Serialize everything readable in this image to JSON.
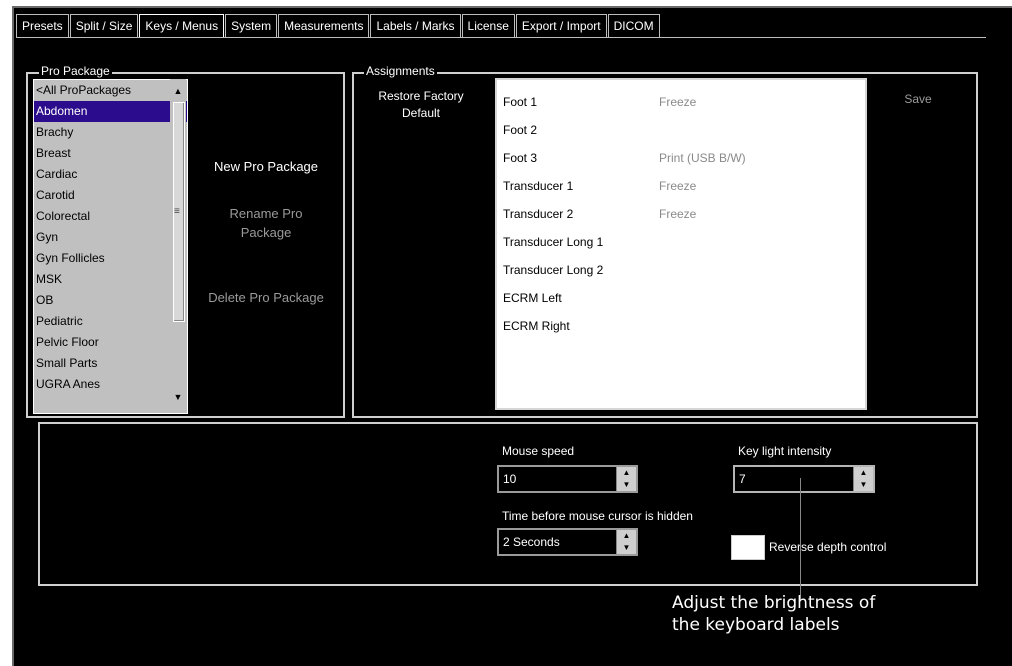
{
  "tabs": [
    "Presets",
    "Split / Size",
    "Keys / Menus",
    "System",
    "Measurements",
    "Labels / Marks",
    "License",
    "Export / Import",
    "DICOM"
  ],
  "pro_package": {
    "legend": "Pro Package",
    "items": [
      "<All ProPackages",
      "Abdomen",
      "Brachy",
      "Breast",
      "Cardiac",
      "Carotid",
      "Colorectal",
      "Gyn",
      "Gyn Follicles",
      "MSK",
      "OB",
      "Pediatric",
      "Pelvic Floor",
      "Small Parts",
      "UGRA Anes"
    ],
    "selected": "Abdomen",
    "new_label": "New Pro Package",
    "rename_label": "Rename Pro\nPackage",
    "delete_label": "Delete Pro Package"
  },
  "assignments": {
    "legend": "Assignments",
    "restore_label": "Restore Factory\nDefault",
    "save_label": "Save",
    "rows": [
      {
        "key": "Foot 1",
        "value": "Freeze"
      },
      {
        "key": "Foot 2",
        "value": ""
      },
      {
        "key": "Foot 3",
        "value": "Print (USB B/W)"
      },
      {
        "key": "Transducer 1",
        "value": "Freeze"
      },
      {
        "key": "Transducer 2",
        "value": "Freeze"
      },
      {
        "key": "Transducer Long 1",
        "value": ""
      },
      {
        "key": "Transducer Long 2",
        "value": ""
      },
      {
        "key": "ECRM Left",
        "value": ""
      },
      {
        "key": "ECRM Right",
        "value": ""
      }
    ]
  },
  "controls": {
    "mouse_speed_label": "Mouse speed",
    "mouse_speed_value": "10",
    "key_light_label": "Key light intensity",
    "key_light_value": "7",
    "hide_cursor_label": "Time before mouse cursor is hidden",
    "hide_cursor_value": "2 Seconds",
    "reverse_depth_label": "Reverse depth control"
  },
  "annotation": "Adjust the brightness of\nthe keyboard labels"
}
